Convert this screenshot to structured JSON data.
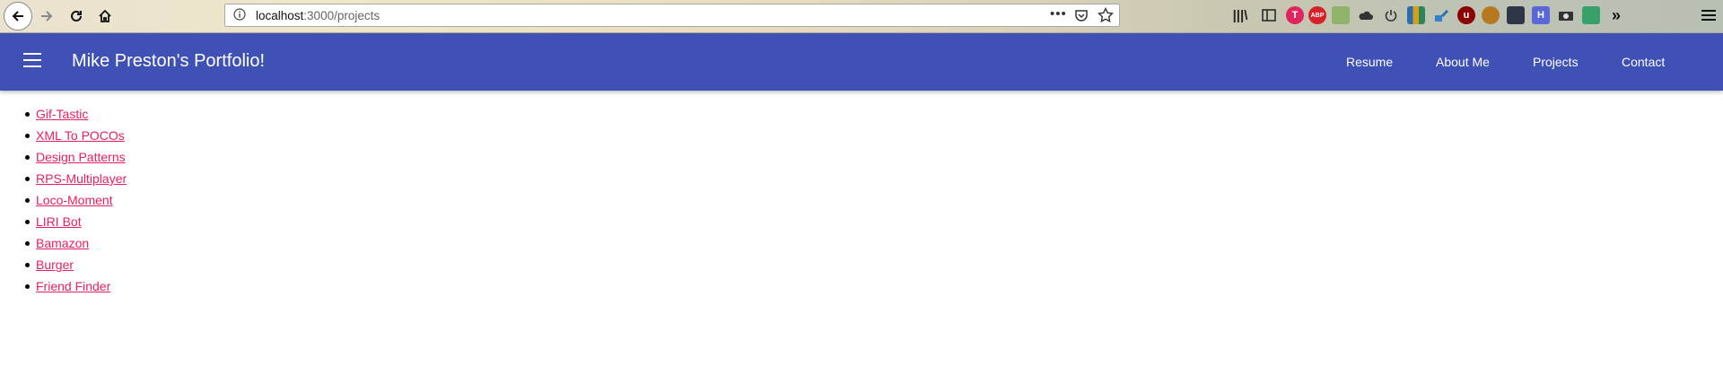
{
  "browser": {
    "url_host": "localhost",
    "url_path": ":3000/projects",
    "more_label": "•••"
  },
  "app": {
    "title": "Mike Preston's Portfolio!",
    "nav": [
      "Resume",
      "About Me",
      "Projects",
      "Contact"
    ],
    "header_color": "#3f51b5",
    "link_color": "#e91e63"
  },
  "projects": [
    "Gif-Tastic",
    "XML To POCOs",
    "Design Patterns",
    "RPS-Multiplayer",
    "Loco-Moment",
    "LIRI Bot",
    "Bamazon",
    "Burger",
    "Friend Finder"
  ],
  "toolbar_icons": [
    "library-icon",
    "reader-icon",
    "tumblr-icon",
    "adblock-plus-icon",
    "extension-icon",
    "cloud-icon",
    "power-icon",
    "bookmarks-icon",
    "paint-icon",
    "ublock-icon",
    "cookie-icon",
    "hat-icon",
    "h-icon",
    "camera-icon",
    "sheet-icon",
    "overflow-icon",
    "hamburger-menu-icon"
  ]
}
